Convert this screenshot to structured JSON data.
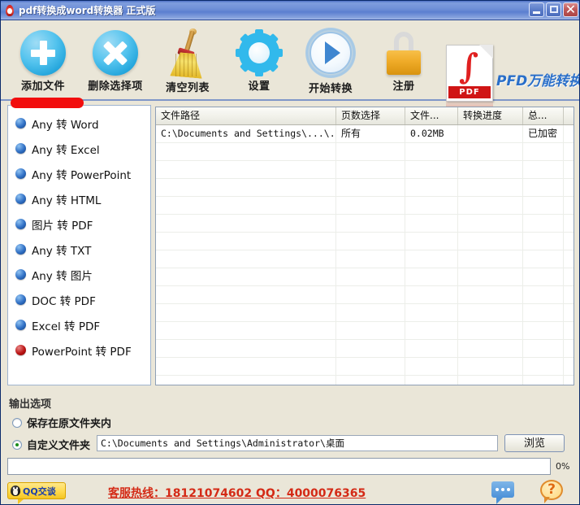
{
  "window": {
    "title": "pdf转换成word转换器  正式版",
    "app_icon": "pdf-app-icon",
    "minimize_label": "",
    "maximize_label": "",
    "close_label": "✕"
  },
  "toolbar": {
    "items": [
      {
        "label": "添加文件",
        "icon": "add-file-plus-icon"
      },
      {
        "label": "删除选择项",
        "icon": "remove-selection-x-icon"
      },
      {
        "label": "清空列表",
        "icon": "broom-clear-list-icon"
      },
      {
        "label": "设置",
        "icon": "gear-settings-icon"
      },
      {
        "label": "开始转换",
        "icon": "play-start-convert-icon"
      },
      {
        "label": "注册",
        "icon": "padlock-register-icon"
      }
    ],
    "brand": {
      "text": "PFD万能转换器",
      "icon": "pdf-document-icon",
      "icon_band_label": "PDF",
      "color": "#2a6fc9"
    }
  },
  "sidebar": {
    "items": [
      {
        "label": "Any 转 Word",
        "bullet": "blue"
      },
      {
        "label": "Any 转 Excel",
        "bullet": "blue"
      },
      {
        "label": "Any 转 PowerPoint",
        "bullet": "blue"
      },
      {
        "label": "Any 转 HTML",
        "bullet": "blue"
      },
      {
        "label": "图片 转 PDF",
        "bullet": "blue"
      },
      {
        "label": "Any 转 TXT",
        "bullet": "blue"
      },
      {
        "label": "Any 转 图片",
        "bullet": "blue"
      },
      {
        "label": "DOC 转 PDF",
        "bullet": "blue"
      },
      {
        "label": "Excel 转 PDF",
        "bullet": "blue"
      },
      {
        "label": "PowerPoint 转 PDF",
        "bullet": "red"
      }
    ],
    "highlight_color": "#f20d0d"
  },
  "file_table": {
    "columns": [
      "文件路径",
      "页数选择",
      "文件...",
      "转换进度",
      "总...",
      ""
    ],
    "rows": [
      {
        "path": "C:\\Documents and Settings\\...\\...",
        "pages": "所有",
        "size": "0.02MB",
        "progress": "",
        "status": "已加密",
        "extra": ""
      }
    ],
    "empty_row_count": 15
  },
  "output": {
    "section_title": "输出选项",
    "option_same_folder": "保存在原文件夹内",
    "option_custom_folder": "自定义文件夹",
    "selected": "custom",
    "path_value": "C:\\Documents and Settings\\Administrator\\桌面",
    "browse_label": "浏览"
  },
  "footer": {
    "progress_percent": "0%",
    "qq_button_label": "QQ交谈",
    "qq_button_icon": "qq-penguin-icon",
    "hotline_text": "客服热线：18121074602 QQ：4000076365",
    "hotline_color": "#d42a16",
    "chat_icon": "chat-bubble-icon",
    "help_icon": "question-mark-help-icon",
    "help_glyph": "?"
  }
}
